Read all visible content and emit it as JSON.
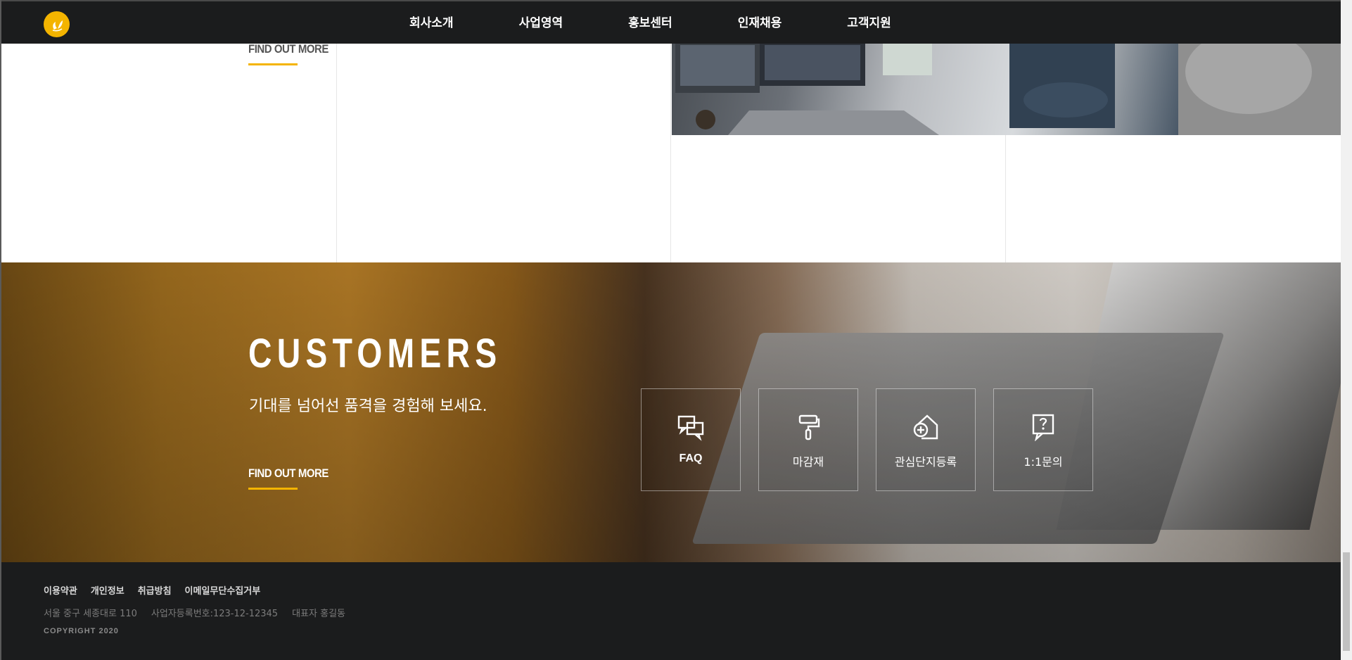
{
  "header": {
    "nav": [
      "회사소개",
      "사업영역",
      "홍보센터",
      "인재채용",
      "고객지원"
    ]
  },
  "upper": {
    "find_more_label": "FIND OUT MORE"
  },
  "customers": {
    "title": "CUSTOMERS",
    "subtitle": "기대를 넘어선 품격을 경험해 보세요.",
    "find_more_label": "FIND OUT MORE",
    "services": [
      {
        "label": "FAQ",
        "icon": "chat-bubbles-icon"
      },
      {
        "label": "마감재",
        "icon": "paint-roller-icon"
      },
      {
        "label": "관심단지등록",
        "icon": "house-add-icon"
      },
      {
        "label": "1:1문의",
        "icon": "question-bubble-icon"
      }
    ]
  },
  "footer": {
    "links": [
      "이용약관",
      "개인정보",
      "취급방침",
      "이메일무단수집거부"
    ],
    "info": [
      "서울 중구 세종대로 110",
      "사업자등록번호:123-12-12345",
      "대표자 홍길동"
    ],
    "copyright": "COPYRIGHT 2020"
  },
  "colors": {
    "accent": "#f4b400",
    "header_bg": "#1b1c1d",
    "footer_bg": "#1b1c1d"
  }
}
